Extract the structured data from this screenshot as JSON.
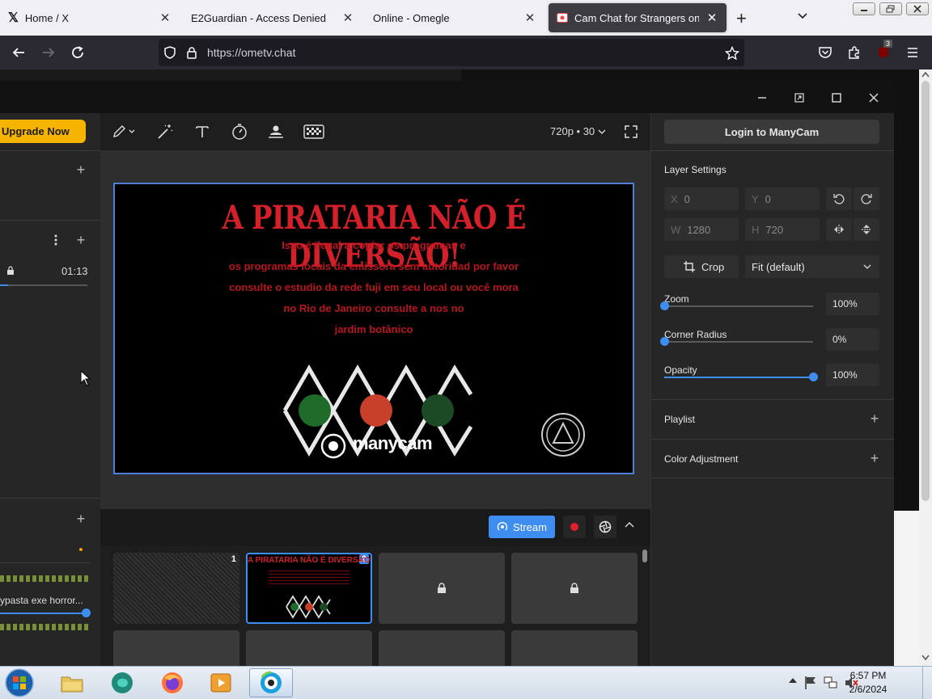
{
  "browser": {
    "tabs": [
      {
        "title": "Home / X",
        "icon": "x-logo-icon"
      },
      {
        "title": "E2Guardian - Access Denied",
        "icon": ""
      },
      {
        "title": "Online - Omegle",
        "icon": ""
      },
      {
        "title": "Cam Chat for Strangers on Ome",
        "icon": "ometv-icon",
        "active": true
      }
    ],
    "new_tab": "+",
    "url": "https://ometv.chat",
    "url_host": "ometv.chat",
    "ublock_badge": "3"
  },
  "manycam": {
    "upgrade_label": "Upgrade Now",
    "left": {
      "time": "01:13",
      "audio_label": "ypasta exe horror..."
    },
    "toolbar": {
      "resolution": "720p • 30"
    },
    "preview": {
      "title": "A PIRATARIA NÃO É DIVERSÃO!",
      "lines": [
        "Isso é ilegal a copiar os programas e",
        "os programas locais da emissora sem autoridad por favor",
        "consulte o estudio da rede fuji em seu local ou você mora",
        "no Rio de Janeiro consulte a nos no",
        "jardim botânico"
      ],
      "brand": "manycam"
    },
    "stream_label": "Stream",
    "scenes": [
      {
        "num": "1"
      },
      {
        "num": "2",
        "title": "A PIRATARIA NÃO É DIVERSÃO!"
      }
    ],
    "right": {
      "login_label": "Login to ManyCam",
      "layer_settings": "Layer Settings",
      "x_key": "X",
      "x_val": "0",
      "y_key": "Y",
      "y_val": "0",
      "w_key": "W",
      "w_val": "1280",
      "h_key": "H",
      "h_val": "720",
      "crop_label": "Crop",
      "fit_label": "Fit (default)",
      "zoom_label": "Zoom",
      "zoom_val": "100%",
      "zoom_level": 0,
      "radius_label": "Corner Radius",
      "radius_val": "0%",
      "radius_level": 0,
      "opacity_label": "Opacity",
      "opacity_val": "100%",
      "opacity_level": 1,
      "playlist_label": "Playlist",
      "color_label": "Color Adjustment"
    }
  },
  "taskbar": {
    "time": "6:57 PM",
    "date": "2/6/2024"
  },
  "colors": {
    "accent": "#3d8ef0",
    "upgrade": "#f5b400",
    "record": "#e0202a",
    "preview_text": "#d3202a"
  }
}
